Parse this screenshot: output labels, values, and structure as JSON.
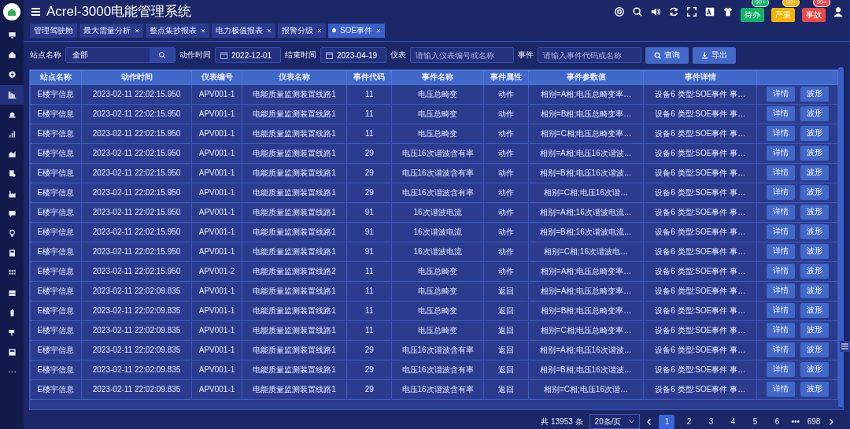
{
  "header": {
    "title": "Acrel-3000电能管理系统",
    "alerts": [
      {
        "label": "待办",
        "count": "99+",
        "color": "#17b26a"
      },
      {
        "label": "严重",
        "count": "99+",
        "color": "#f5b400"
      },
      {
        "label": "事故",
        "count": "99+",
        "color": "#e84a4a"
      }
    ]
  },
  "sidebar": {
    "items": [
      {
        "selected": false
      },
      {
        "selected": false
      },
      {
        "selected": false
      },
      {
        "selected": true
      },
      {
        "selected": false
      },
      {
        "selected": false
      },
      {
        "selected": false
      },
      {
        "selected": false
      },
      {
        "selected": false
      },
      {
        "selected": false
      },
      {
        "selected": false
      },
      {
        "selected": false
      },
      {
        "selected": false
      },
      {
        "selected": false
      },
      {
        "selected": false
      },
      {
        "selected": false
      },
      {
        "selected": false
      }
    ]
  },
  "tabs": [
    {
      "label": "管理驾驶舱",
      "closable": false,
      "selected": false
    },
    {
      "label": "最大需量分析",
      "closable": true,
      "selected": false
    },
    {
      "label": "整点集抄报表",
      "closable": true,
      "selected": false
    },
    {
      "label": "电力极值报表",
      "closable": true,
      "selected": false
    },
    {
      "label": "报警分级",
      "closable": true,
      "selected": false
    },
    {
      "label": "SOE事件",
      "closable": true,
      "selected": true
    }
  ],
  "filters": {
    "site_label": "站点名称",
    "site_value": "全部",
    "start_label": "动作时间",
    "start_value": "2022-12-01",
    "end_label": "结束时间",
    "end_value": "2023-04-19",
    "meter_label": "仪表",
    "meter_placeholder": "请输入仪表编号或名称",
    "event_label": "事件",
    "event_placeholder": "请输入事件代码或名称",
    "query_button": "查询",
    "export_button": "导出"
  },
  "table": {
    "columns": [
      "站点名称",
      "动作时间",
      "仪表编号",
      "仪表名称",
      "事件代码",
      "事件名称",
      "事件属性",
      "事件参数值",
      "事件详情"
    ],
    "rows": [
      {
        "cells": [
          "E楼宇信息",
          "2023-02-11 22:02:15.950",
          "APV001-1",
          "电能质量监测装置线路1",
          "11",
          "电压总畸变",
          "动作",
          "相别=A相;电压总畸变率…",
          "设备6 类型:SOE事件 事…"
        ],
        "actions": [
          "详情",
          "波形"
        ]
      },
      {
        "cells": [
          "E楼宇信息",
          "2023-02-11 22:02:15.950",
          "APV001-1",
          "电能质量监测装置线路1",
          "11",
          "电压总畸变",
          "动作",
          "相别=B相;电压总畸变率…",
          "设备6 类型:SOE事件 事…"
        ],
        "actions": [
          "详情",
          "波形"
        ]
      },
      {
        "cells": [
          "E楼宇信息",
          "2023-02-11 22:02:15.950",
          "APV001-1",
          "电能质量监测装置线路1",
          "11",
          "电压总畸变",
          "动作",
          "相别=C相;电压总畸变率…",
          "设备6 类型:SOE事件 事…"
        ],
        "actions": [
          "详情",
          "波形"
        ]
      },
      {
        "cells": [
          "E楼宇信息",
          "2023-02-11 22:02:15.950",
          "APV001-1",
          "电能质量监测装置线路1",
          "29",
          "电压16次谐波含有率",
          "动作",
          "相别=A相;电压16次谐波…",
          "设备6 类型:SOE事件 事…"
        ],
        "actions": [
          "详情",
          "波形"
        ]
      },
      {
        "cells": [
          "E楼宇信息",
          "2023-02-11 22:02:15.950",
          "APV001-1",
          "电能质量监测装置线路1",
          "29",
          "电压16次谐波含有率",
          "动作",
          "相别=B相;电压16次谐波…",
          "设备6 类型:SOE事件 事…"
        ],
        "actions": [
          "详情",
          "波形"
        ]
      },
      {
        "cells": [
          "E楼宇信息",
          "2023-02-11 22:02:15.950",
          "APV001-1",
          "电能质量监测装置线路1",
          "29",
          "电压16次谐波含有率",
          "动作",
          "相别=C相;电压16次谐…",
          "设备6 类型:SOE事件 事…"
        ],
        "actions": [
          "详情",
          "波形"
        ]
      },
      {
        "cells": [
          "E楼宇信息",
          "2023-02-11 22:02:15.950",
          "APV001-1",
          "电能质量监测装置线路1",
          "91",
          "16次谐波电流",
          "动作",
          "相别=A相;16次谐波电流…",
          "设备6 类型:SOE事件 事…"
        ],
        "actions": [
          "详情",
          "波形"
        ]
      },
      {
        "cells": [
          "E楼宇信息",
          "2023-02-11 22:02:15.950",
          "APV001-1",
          "电能质量监测装置线路1",
          "91",
          "16次谐波电流",
          "动作",
          "相别=B相;16次谐波电流…",
          "设备6 类型:SOE事件 事…"
        ],
        "actions": [
          "详情",
          "波形"
        ]
      },
      {
        "cells": [
          "E楼宇信息",
          "2023-02-11 22:02:15.950",
          "APV001-1",
          "电能质量监测装置线路1",
          "91",
          "16次谐波电流",
          "动作",
          "相别=C相;16次谐波电…",
          "设备6 类型:SOE事件 事…"
        ],
        "actions": [
          "详情",
          "波形"
        ]
      },
      {
        "cells": [
          "E楼宇信息",
          "2023-02-11 22:02:15.950",
          "APV001-2",
          "电能质量监测装置线路2",
          "11",
          "电压总畸变",
          "动作",
          "相别=A相;电压总畸变率…",
          "设备6 类型:SOE事件 事…"
        ],
        "actions": [
          "详情",
          "波形"
        ]
      },
      {
        "cells": [
          "E楼宇信息",
          "2023-02-11 22:02:09.835",
          "APV001-1",
          "电能质量监测装置线路1",
          "11",
          "电压总畸变",
          "返回",
          "相别=A相;电压总畸变率…",
          "设备6 类型:SOE事件 事…"
        ],
        "actions": [
          "详情",
          "波形"
        ]
      },
      {
        "cells": [
          "E楼宇信息",
          "2023-02-11 22:02:09.835",
          "APV001-1",
          "电能质量监测装置线路1",
          "11",
          "电压总畸变",
          "返回",
          "相别=B相;电压总畸变率…",
          "设备6 类型:SOE事件 事…"
        ],
        "actions": [
          "详情",
          "波形"
        ]
      },
      {
        "cells": [
          "E楼宇信息",
          "2023-02-11 22:02:09.835",
          "APV001-1",
          "电能质量监测装置线路1",
          "11",
          "电压总畸变",
          "返回",
          "相别=C相;电压总畸变率…",
          "设备6 类型:SOE事件 事…"
        ],
        "actions": [
          "详情",
          "波形"
        ]
      },
      {
        "cells": [
          "E楼宇信息",
          "2023-02-11 22:02:09.835",
          "APV001-1",
          "电能质量监测装置线路1",
          "29",
          "电压16次谐波含有率",
          "返回",
          "相别=A相;电压16次谐波…",
          "设备6 类型:SOE事件 事…"
        ],
        "actions": [
          "详情",
          "波形"
        ]
      },
      {
        "cells": [
          "E楼宇信息",
          "2023-02-11 22:02:09.835",
          "APV001-1",
          "电能质量监测装置线路1",
          "29",
          "电压16次谐波含有率",
          "返回",
          "相别=B相;电压16次谐波…",
          "设备6 类型:SOE事件 事…"
        ],
        "actions": [
          "详情",
          "波形"
        ]
      },
      {
        "cells": [
          "E楼宇信息",
          "2023-02-11 22:02:09.835",
          "APV001-1",
          "电能质量监测装置线路1",
          "29",
          "电压16次谐波含有率",
          "返回",
          "相别=C相;电压16次谐…",
          "设备6 类型:SOE事件 事…"
        ],
        "actions": [
          "详情",
          "波形"
        ]
      }
    ]
  },
  "pagination": {
    "total": "共 13953 条",
    "page_size": "20条/页",
    "pages": [
      {
        "label": "1",
        "selected": true
      },
      {
        "label": "2",
        "selected": false
      },
      {
        "label": "3",
        "selected": false
      },
      {
        "label": "4",
        "selected": false
      },
      {
        "label": "5",
        "selected": false
      },
      {
        "label": "6",
        "selected": false
      }
    ],
    "ellipsis": "•••",
    "last_page": "698"
  }
}
